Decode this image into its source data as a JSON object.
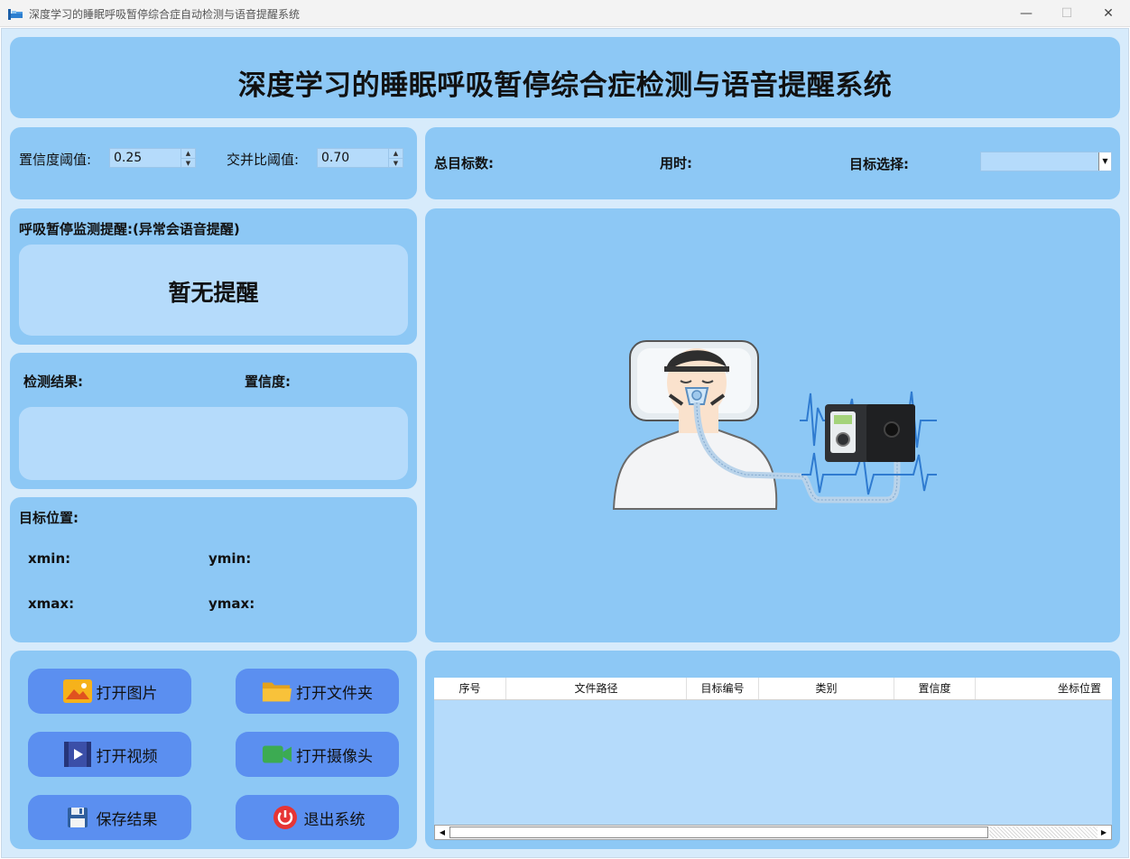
{
  "window": {
    "title": "深度学习的睡眠呼吸暂停综合症自动检测与语音提醒系统",
    "minimize": "—",
    "maximize": "☐",
    "close": "✕"
  },
  "header": {
    "title": "深度学习的睡眠呼吸暂停综合症检测与语音提醒系统"
  },
  "thresholds": {
    "confidence_label": "置信度阈值:",
    "confidence_value": "0.25",
    "iou_label": "交并比阈值:",
    "iou_value": "0.70"
  },
  "stats": {
    "total_label": "总目标数:",
    "time_label": "用时:",
    "select_label": "目标选择:",
    "select_value": ""
  },
  "alert": {
    "heading": "呼吸暂停监测提醒:(异常会语音提醒)",
    "message": "暂无提醒"
  },
  "result": {
    "result_label": "检测结果:",
    "confidence_label": "置信度:"
  },
  "position": {
    "heading": "目标位置:",
    "xmin": "xmin:",
    "ymin": "ymin:",
    "xmax": "xmax:",
    "ymax": "ymax:"
  },
  "buttons": {
    "open_image": "打开图片",
    "open_folder": "打开文件夹",
    "open_video": "打开视频",
    "open_camera": "打开摄像头",
    "save": "保存结果",
    "exit": "退出系统"
  },
  "table": {
    "columns": [
      "序号",
      "文件路径",
      "目标编号",
      "类别",
      "置信度",
      "坐标位置"
    ]
  },
  "colors": {
    "panel": "#8dc8f5",
    "inner": "#b5dbfb",
    "button": "#5b8ff0",
    "background": "#d7ebfb"
  }
}
